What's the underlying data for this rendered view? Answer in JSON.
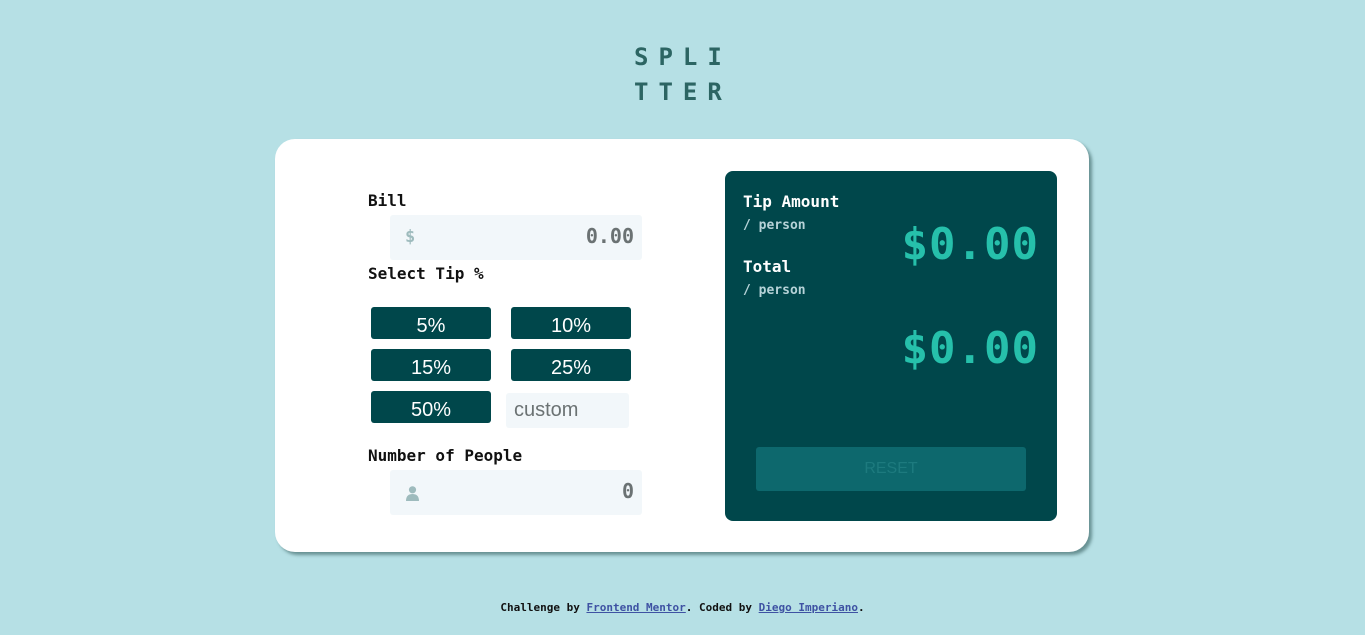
{
  "app": {
    "logo_line1": "SPLI",
    "logo_line2": "TTER"
  },
  "form": {
    "bill_label": "Bill",
    "bill_prefix": "$",
    "bill_value": "0.00",
    "tip_label": "Select Tip %",
    "tips": [
      "5%",
      "10%",
      "15%",
      "25%",
      "50%"
    ],
    "custom_placeholder": "custom",
    "people_label": "Number of People",
    "people_value": "0"
  },
  "results": {
    "tip_label": "Tip Amount",
    "tip_sub": "/ person",
    "tip_value": "$0.00",
    "total_label": "Total",
    "total_sub": "/ person",
    "total_value": "$0.00",
    "reset_label": "RESET"
  },
  "footer": {
    "prefix": "Challenge by ",
    "link1": "Frontend Mentor",
    "middle": ". Coded by ",
    "link2": "Diego Imperiano",
    "suffix": "."
  },
  "colors": {
    "background": "#b6e0e5",
    "dark_cyan": "#00474b",
    "strong_cyan": "#26c0ab"
  }
}
